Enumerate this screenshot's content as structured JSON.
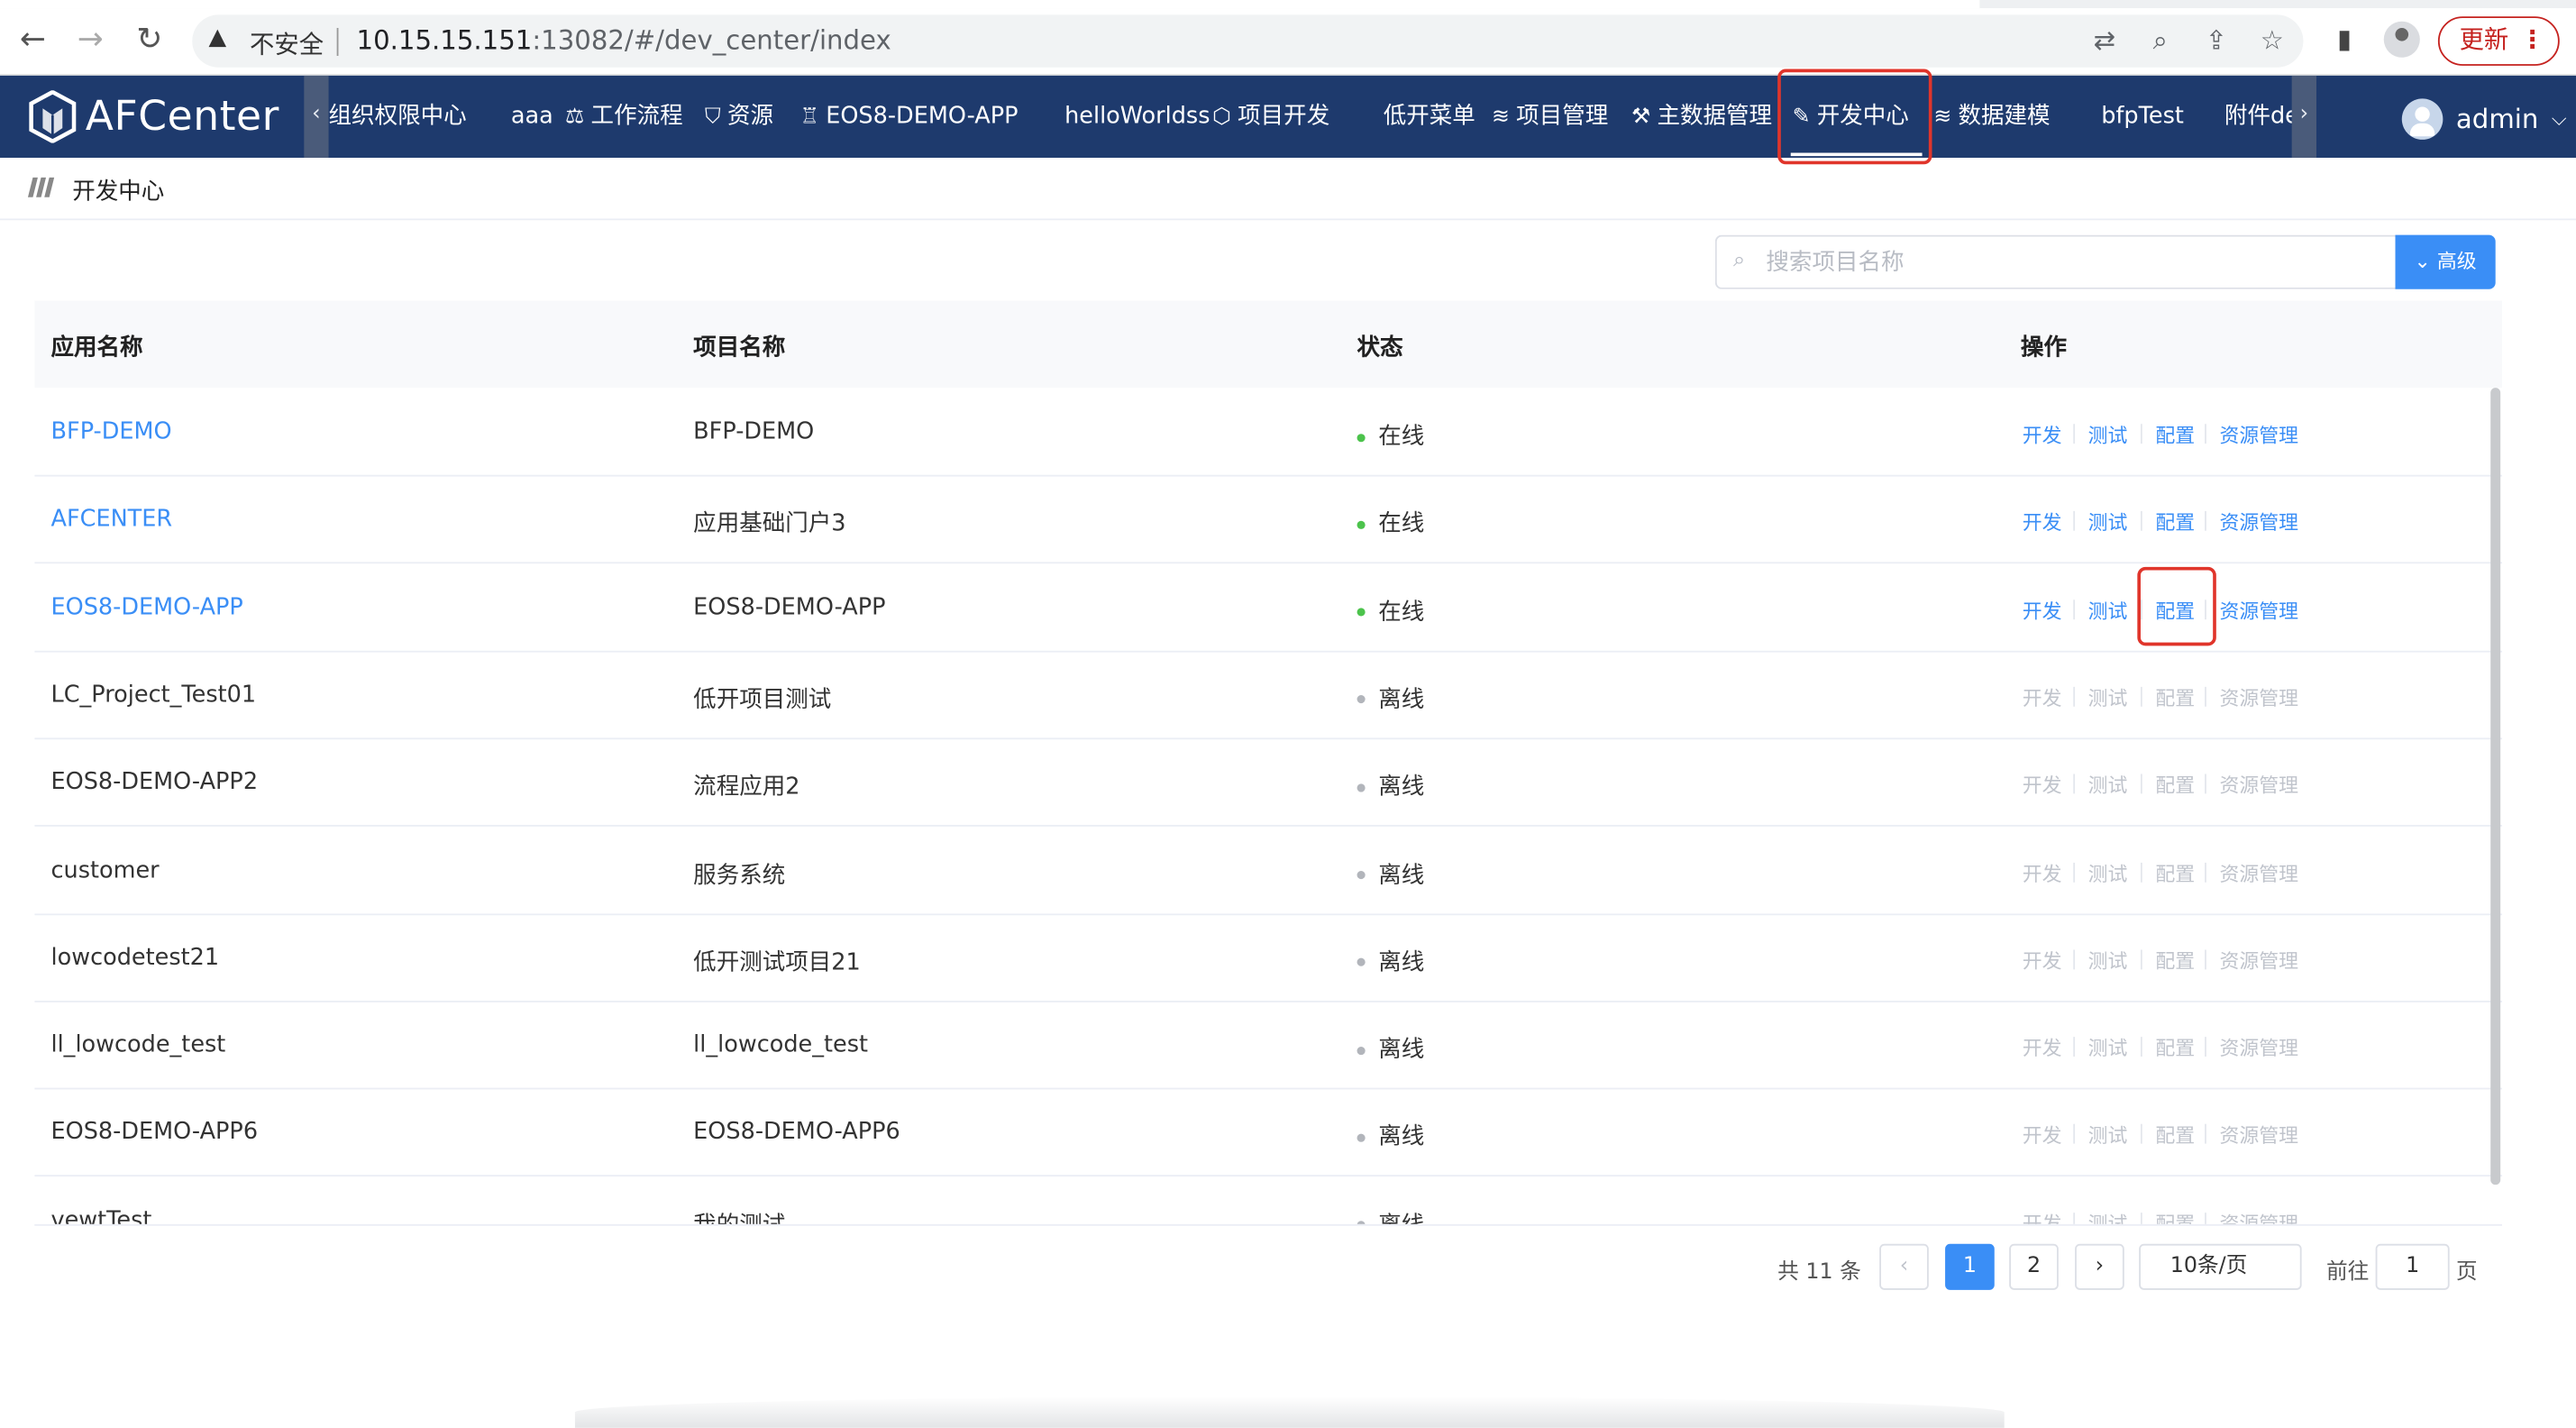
{
  "browser": {
    "insecure_label": "不安全",
    "url_host": "10.15.15.151",
    "url_rest": ":13082/#/dev_center/index",
    "update_label": "更新"
  },
  "app": {
    "logo_text": "AFCenter",
    "user_name": "admin"
  },
  "menu": [
    {
      "label": "组织权限中心",
      "icon": ""
    },
    {
      "label": "aaa",
      "icon": ""
    },
    {
      "label": "工作流程",
      "icon": "scale-icon"
    },
    {
      "label": "资源",
      "icon": "shield-icon"
    },
    {
      "label": "EOS8-DEMO-APP",
      "icon": "bell-icon"
    },
    {
      "label": "helloWorldss",
      "icon": ""
    },
    {
      "label": "项目开发",
      "icon": "cube-icon"
    },
    {
      "label": "低开菜单",
      "icon": ""
    },
    {
      "label": "项目管理",
      "icon": "layers-icon"
    },
    {
      "label": "主数据管理",
      "icon": "tools-icon"
    },
    {
      "label": "开发中心",
      "icon": "edit-icon"
    },
    {
      "label": "数据建模",
      "icon": "layers-icon"
    },
    {
      "label": "bfpTest",
      "icon": ""
    },
    {
      "label": "附件de",
      "icon": ""
    }
  ],
  "breadcrumb": "开发中心",
  "search": {
    "placeholder": "搜索项目名称",
    "advanced_label": "高级"
  },
  "table": {
    "headers": [
      "应用名称",
      "项目名称",
      "状态",
      "操作"
    ],
    "ops": [
      "开发",
      "测试",
      "配置",
      "资源管理"
    ],
    "rows": [
      {
        "app": "BFP-DEMO",
        "project": "BFP-DEMO",
        "status": "在线",
        "online": true
      },
      {
        "app": "AFCENTER",
        "project": "应用基础门户3",
        "status": "在线",
        "online": true
      },
      {
        "app": "EOS8-DEMO-APP",
        "project": "EOS8-DEMO-APP",
        "status": "在线",
        "online": true
      },
      {
        "app": "LC_Project_Test01",
        "project": "低开项目测试",
        "status": "离线",
        "online": false
      },
      {
        "app": "EOS8-DEMO-APP2",
        "project": "流程应用2",
        "status": "离线",
        "online": false
      },
      {
        "app": "customer",
        "project": "服务系统",
        "status": "离线",
        "online": false
      },
      {
        "app": "lowcodetest21",
        "project": "低开测试项目21",
        "status": "离线",
        "online": false
      },
      {
        "app": "ll_lowcode_test",
        "project": "ll_lowcode_test",
        "status": "离线",
        "online": false
      },
      {
        "app": "EOS8-DEMO-APP6",
        "project": "EOS8-DEMO-APP6",
        "status": "离线",
        "online": false
      },
      {
        "app": "vewtTest",
        "project": "我的测试",
        "status": "离线",
        "online": false
      }
    ]
  },
  "pagination": {
    "total": "共 11 条",
    "pages": [
      "1",
      "2"
    ],
    "current": "1",
    "page_size": "10条/页",
    "goto_label": "前往",
    "goto_value": "1",
    "page_suffix": "页"
  }
}
